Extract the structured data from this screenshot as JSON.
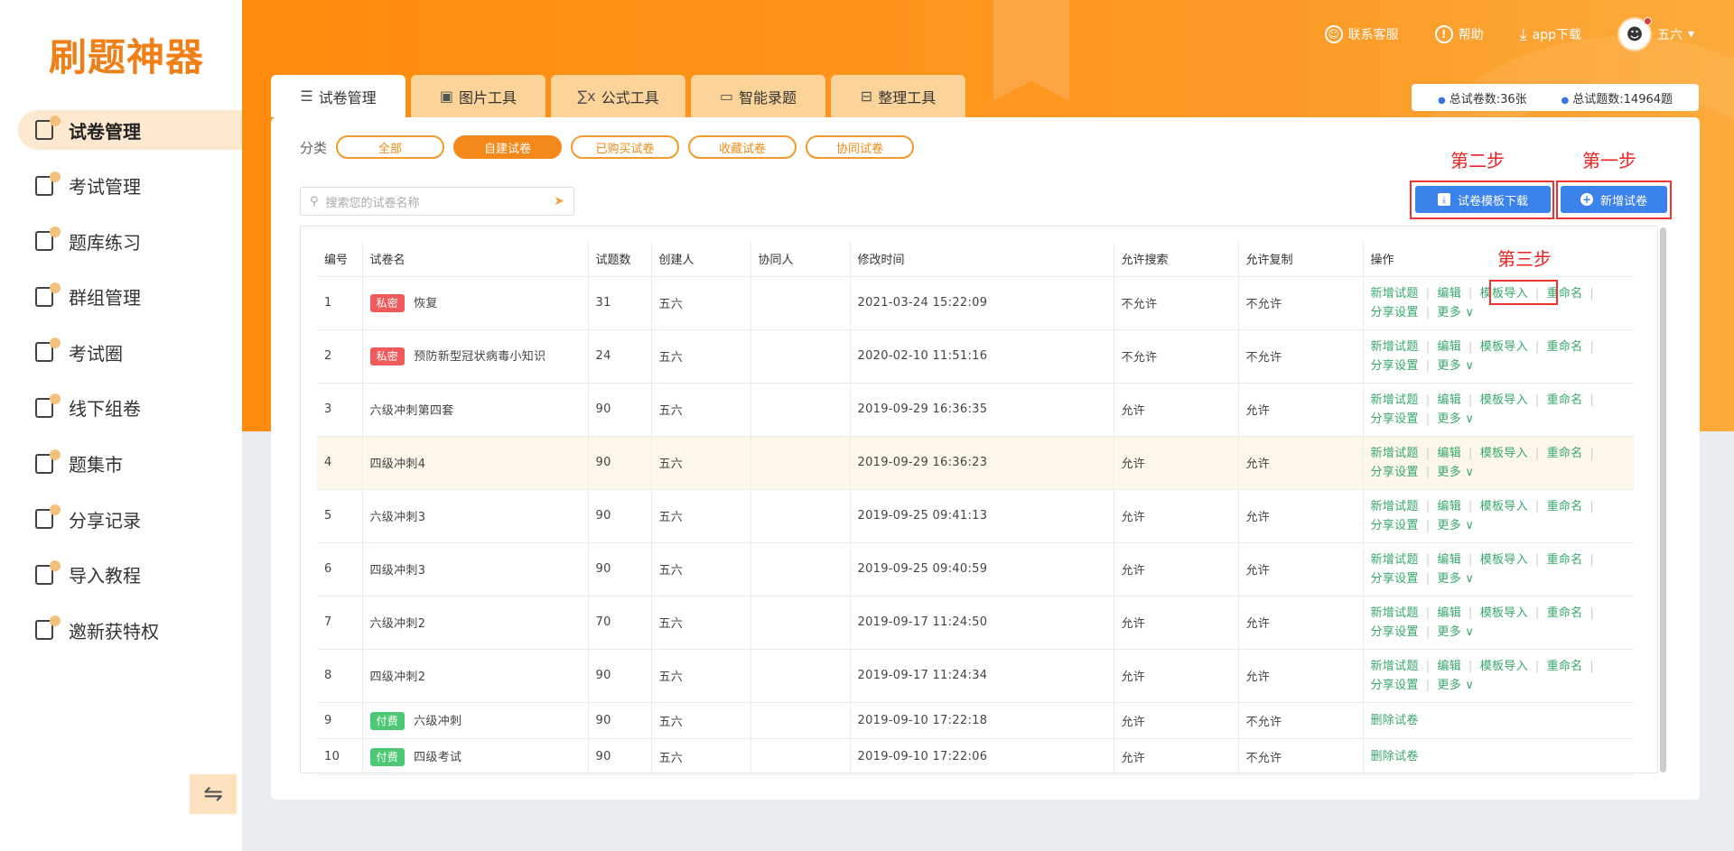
{
  "logo": "刷题神器",
  "sidebar": {
    "items": [
      {
        "label": "试卷管理",
        "icon": "document-icon",
        "active": true
      },
      {
        "label": "考试管理",
        "icon": "pencil-icon"
      },
      {
        "label": "题库练习",
        "icon": "book-icon"
      },
      {
        "label": "群组管理",
        "icon": "group-icon"
      },
      {
        "label": "考试圈",
        "icon": "badge-icon"
      },
      {
        "label": "线下组卷",
        "icon": "stack-icon"
      },
      {
        "label": "题集市",
        "icon": "store-icon"
      },
      {
        "label": "分享记录",
        "icon": "share-icon"
      },
      {
        "label": "导入教程",
        "icon": "import-icon"
      },
      {
        "label": "邀新获特权",
        "icon": "gift-icon"
      }
    ],
    "collapse_icon": "⇋"
  },
  "topbar": {
    "service": "联系客服",
    "help": "帮助",
    "app": "app下载",
    "user": "五六"
  },
  "tabs": [
    {
      "label": "试卷管理",
      "icon": "☰"
    },
    {
      "label": "图片工具",
      "icon": "▣"
    },
    {
      "label": "公式工具",
      "icon": "∑x"
    },
    {
      "label": "智能录题",
      "icon": "▭"
    },
    {
      "label": "整理工具",
      "icon": "⊟"
    }
  ],
  "stats": {
    "papers": "总试卷数:36张",
    "questions": "总试题数:14964题"
  },
  "filter": {
    "label": "分类",
    "chips": [
      "全部",
      "自建试卷",
      "已购买试卷",
      "收藏试卷",
      "协同试卷"
    ]
  },
  "search": {
    "placeholder": "搜索您的试卷名称"
  },
  "steps": {
    "one": "第一步",
    "two": "第二步",
    "three": "第三步"
  },
  "buttons": {
    "download": "试卷模板下载",
    "add": "新增试卷"
  },
  "table": {
    "headers": [
      "编号",
      "试卷名",
      "试题数",
      "创建人",
      "协同人",
      "修改时间",
      "允许搜索",
      "允许复制",
      "操作"
    ],
    "ops": {
      "add_q": "新增试题",
      "edit": "编辑",
      "import": "模板导入",
      "rename": "重命名",
      "share": "分享设置",
      "more": "更多 ∨",
      "delete": "删除试卷"
    },
    "rows": [
      {
        "no": "1",
        "tag": "私密",
        "name": "恢复",
        "count": "31",
        "creator": "五六",
        "co": "",
        "time": "2021-03-24 15:22:09",
        "search": "不允许",
        "copy": "不允许"
      },
      {
        "no": "2",
        "tag": "私密",
        "name": "预防新型冠状病毒小知识",
        "count": "24",
        "creator": "五六",
        "co": "",
        "time": "2020-02-10 11:51:16",
        "search": "不允许",
        "copy": "不允许"
      },
      {
        "no": "3",
        "tag": "",
        "name": "六级冲刺第四套",
        "count": "90",
        "creator": "五六",
        "co": "",
        "time": "2019-09-29 16:36:35",
        "search": "允许",
        "copy": "允许"
      },
      {
        "no": "4",
        "tag": "",
        "name": "四级冲刺4",
        "count": "90",
        "creator": "五六",
        "co": "",
        "time": "2019-09-29 16:36:23",
        "search": "允许",
        "copy": "允许"
      },
      {
        "no": "5",
        "tag": "",
        "name": "六级冲刺3",
        "count": "90",
        "creator": "五六",
        "co": "",
        "time": "2019-09-25 09:41:13",
        "search": "允许",
        "copy": "允许"
      },
      {
        "no": "6",
        "tag": "",
        "name": "四级冲刺3",
        "count": "90",
        "creator": "五六",
        "co": "",
        "time": "2019-09-25 09:40:59",
        "search": "允许",
        "copy": "允许"
      },
      {
        "no": "7",
        "tag": "",
        "name": "六级冲刺2",
        "count": "70",
        "creator": "五六",
        "co": "",
        "time": "2019-09-17 11:24:50",
        "search": "允许",
        "copy": "允许"
      },
      {
        "no": "8",
        "tag": "",
        "name": "四级冲刺2",
        "count": "90",
        "creator": "五六",
        "co": "",
        "time": "2019-09-17 11:24:34",
        "search": "允许",
        "copy": "允许"
      },
      {
        "no": "9",
        "tag": "付费",
        "name": "六级冲刺",
        "count": "90",
        "creator": "五六",
        "co": "",
        "time": "2019-09-10 17:22:18",
        "search": "允许",
        "copy": "不允许"
      },
      {
        "no": "10",
        "tag": "付费",
        "name": "四级考试",
        "count": "90",
        "creator": "五六",
        "co": "",
        "time": "2019-09-10 17:22:06",
        "search": "允许",
        "copy": "不允许"
      }
    ]
  }
}
